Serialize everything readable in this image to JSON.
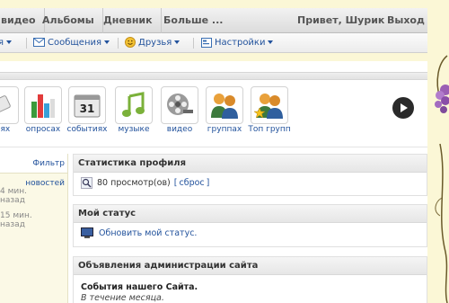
{
  "topnav": {
    "tabs": [
      "видео",
      "Альбомы",
      "Дневник",
      "Больше ..."
    ],
    "greeting": "Привет, Шурик",
    "logout": "Выход"
  },
  "subnav": {
    "items": [
      {
        "label": "я",
        "icon": "none"
      },
      {
        "label": "Сообщения",
        "icon": "envelope-icon"
      },
      {
        "label": "Друзья",
        "icon": "smiley-icon"
      },
      {
        "label": "Настройки",
        "icon": "settings-icon"
      }
    ]
  },
  "apps": [
    {
      "label": "ниях"
    },
    {
      "label": "опросах"
    },
    {
      "label": "событиях",
      "badge": "31"
    },
    {
      "label": "музыке"
    },
    {
      "label": "видео"
    },
    {
      "label": "группах"
    },
    {
      "label": "Топ групп"
    }
  ],
  "feed": {
    "filter": "Фильтр новостей",
    "times": [
      "4 мин. назад",
      "15 мин. назад"
    ]
  },
  "stats": {
    "title": "Статистика профиля",
    "views": "80 просмотр(ов)",
    "reset_open": "[",
    "reset": "сброс",
    "reset_close": "]"
  },
  "status": {
    "title": "Мой статус",
    "update": "Обновить мой статус."
  },
  "admin": {
    "title": "Объявления администрации сайта",
    "event_title": "События нашего Сайта.",
    "event_sub": "В течение месяца."
  },
  "colors": {
    "link": "#22529c",
    "background": "#fbf7d6"
  }
}
